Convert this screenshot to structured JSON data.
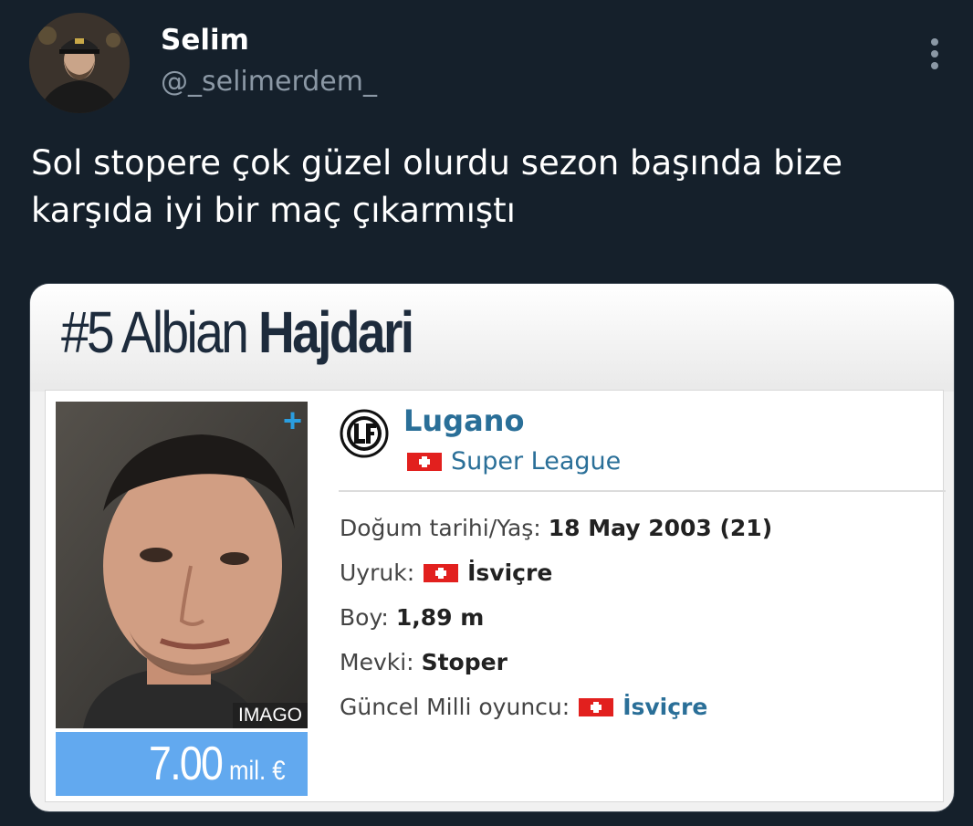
{
  "tweet": {
    "display_name": "Selim",
    "handle": "@_selimerdem_",
    "text": "Sol stopere çok güzel olurdu sezon başında bize karşıda iyi bir maç çıkarmıştı",
    "more_icon": "more-vertical-icon"
  },
  "card": {
    "title_number": "#5",
    "title_first": "Albian",
    "title_last": "Hajdari",
    "photo_credit": "IMAGO",
    "plus_icon": "+",
    "market_value": "7.00",
    "market_value_unit": "mil. €",
    "club": "Lugano",
    "league": "Super League",
    "info": {
      "birth_label": "Doğum tarihi/Yaş:",
      "birth_value": "18 May 2003 (21)",
      "nationality_label": "Uyruk:",
      "nationality_value": "İsviçre",
      "height_label": "Boy:",
      "height_value": "1,89 m",
      "position_label": "Mevki:",
      "position_value": "Stoper",
      "national_team_label": "Güncel Milli oyuncu:",
      "national_team_value": "İsviçre"
    }
  },
  "colors": {
    "background": "#15202b",
    "link": "#2a6f98",
    "value_box": "#62a9ef",
    "swiss_red": "#e2201e"
  }
}
